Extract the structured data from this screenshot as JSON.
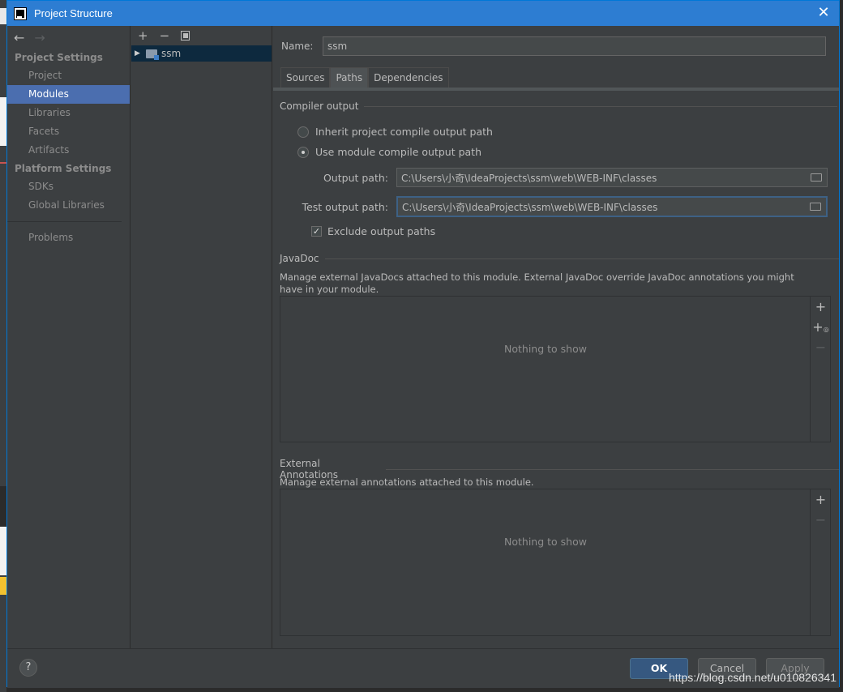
{
  "window": {
    "title": "Project Structure",
    "close_glyph": "✕"
  },
  "nav": {
    "back_glyph": "←",
    "forward_glyph": "→",
    "project_settings_header": "Project Settings",
    "project_items": [
      "Project",
      "Modules",
      "Libraries",
      "Facets",
      "Artifacts"
    ],
    "selected": "Modules",
    "platform_settings_header": "Platform Settings",
    "platform_items": [
      "SDKs",
      "Global Libraries"
    ],
    "problems": "Problems"
  },
  "tree": {
    "add_glyph": "+",
    "remove_glyph": "−",
    "module_name": "ssm"
  },
  "main": {
    "name_label": "Name:",
    "name_value": "ssm",
    "tabs": [
      "Sources",
      "Paths",
      "Dependencies"
    ],
    "active_tab": "Paths",
    "compiler_output_title": "Compiler output",
    "inherit_label": "Inherit project compile output path",
    "use_module_label": "Use module compile output path",
    "output_path_label": "Output path:",
    "output_path_value": "C:\\Users\\小奇\\IdeaProjects\\ssm\\web\\WEB-INF\\classes",
    "test_output_path_label": "Test output path:",
    "test_output_path_value": "C:\\Users\\小奇\\IdeaProjects\\ssm\\web\\WEB-INF\\classes",
    "exclude_label": "Exclude output paths",
    "javadoc_title": "JavaDoc",
    "javadoc_desc": "Manage external JavaDocs attached to this module. External JavaDoc override JavaDoc annotations you might have in your module.",
    "javadoc_empty": "Nothing to show",
    "ext_annotations_title": "External Annotations",
    "ext_annotations_desc": "Manage external annotations attached to this module.",
    "ext_annotations_empty": "Nothing to show"
  },
  "footer": {
    "help_glyph": "?",
    "ok_label": "OK",
    "cancel_label": "Cancel",
    "apply_label": "Apply"
  },
  "watermark": "https://blog.csdn.net/u010826341"
}
